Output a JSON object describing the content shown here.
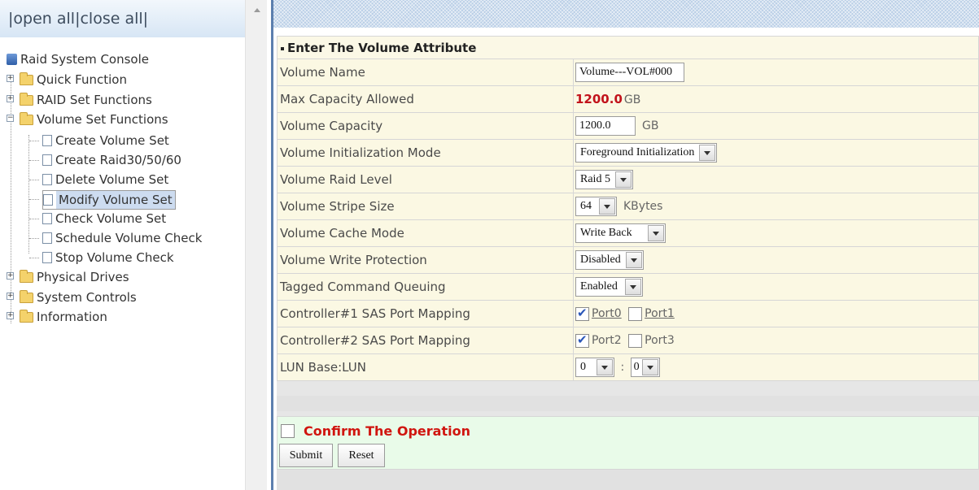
{
  "left_pane": {
    "open_all": "open all",
    "close_all": "close all",
    "separator": "|",
    "tree": {
      "root": "Raid System Console",
      "items": [
        {
          "label": "Quick Function",
          "expanded": false
        },
        {
          "label": "RAID Set Functions",
          "expanded": false
        },
        {
          "label": "Volume Set Functions",
          "expanded": true,
          "children": [
            "Create Volume Set",
            "Create Raid30/50/60",
            "Delete Volume Set",
            "Modify Volume Set",
            "Check Volume Set",
            "Schedule Volume Check",
            "Stop Volume Check"
          ],
          "selected_child": "Modify Volume Set"
        },
        {
          "label": "Physical Drives",
          "expanded": false
        },
        {
          "label": "System Controls",
          "expanded": false
        },
        {
          "label": "Information",
          "expanded": false
        }
      ]
    }
  },
  "form": {
    "header": "Enter The Volume Attribute",
    "rows": {
      "volume_name": {
        "label": "Volume Name",
        "value": "Volume---VOL#000"
      },
      "max_capacity": {
        "label": "Max Capacity Allowed",
        "value": "1200.0",
        "unit": "GB"
      },
      "volume_capacity": {
        "label": "Volume Capacity",
        "value": "1200.0",
        "unit": "GB"
      },
      "init_mode": {
        "label": "Volume Initialization Mode",
        "value": "Foreground Initialization"
      },
      "raid_level": {
        "label": "Volume Raid Level",
        "value": "Raid 5"
      },
      "stripe_size": {
        "label": "Volume Stripe Size",
        "value": "64",
        "unit": "KBytes"
      },
      "cache_mode": {
        "label": "Volume Cache Mode",
        "value": "Write Back"
      },
      "write_protection": {
        "label": "Volume Write Protection",
        "value": "Disabled"
      },
      "tcq": {
        "label": "Tagged Command Queuing",
        "value": "Enabled"
      },
      "ctrl1": {
        "label": "Controller#1 SAS Port Mapping",
        "port_a": "Port0",
        "port_a_checked": true,
        "port_b": "Port1",
        "port_b_checked": false
      },
      "ctrl2": {
        "label": "Controller#2 SAS Port Mapping",
        "port_a": "Port2",
        "port_a_checked": true,
        "port_b": "Port3",
        "port_b_checked": false
      },
      "lun": {
        "label": "LUN Base:LUN",
        "base": "0",
        "sep": ":",
        "lun": "0"
      }
    },
    "confirm_label": "Confirm The Operation",
    "submit_label": "Submit",
    "reset_label": "Reset"
  },
  "colors": {
    "row_bg": "#fbf8e3",
    "confirm_bg": "#e9fbe9",
    "capacity_red": "#c2121b",
    "confirm_red": "#d0150f"
  }
}
